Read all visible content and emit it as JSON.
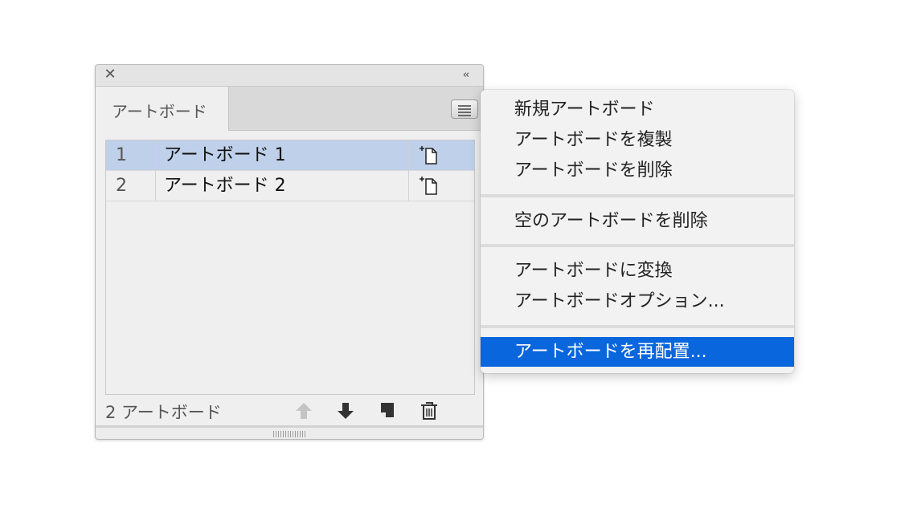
{
  "panel": {
    "close_glyph": "✕",
    "collapse_glyph": "‹‹",
    "tab_label": "アートボード",
    "rows": [
      {
        "number": "1",
        "name": "アートボード 1",
        "selected": true
      },
      {
        "number": "2",
        "name": "アートボード 2",
        "selected": false
      }
    ],
    "footer_count": "2 アートボード",
    "icons": {
      "menu": "panel-menu-icon",
      "row_options": "artboard-options-icon",
      "move_up": "arrow-up-icon",
      "move_down": "arrow-down-icon",
      "new": "new-artboard-icon",
      "delete": "trash-icon"
    }
  },
  "menu": {
    "groups": [
      [
        "新規アートボード",
        "アートボードを複製",
        "アートボードを削除"
      ],
      [
        "空のアートボードを削除"
      ],
      [
        "アートボードに変換",
        "アートボードオプション..."
      ],
      [
        "アートボードを再配置..."
      ]
    ],
    "highlighted": "アートボードを再配置..."
  },
  "colors": {
    "selection": "#bfd0ea",
    "menu_highlight": "#0966dc"
  }
}
